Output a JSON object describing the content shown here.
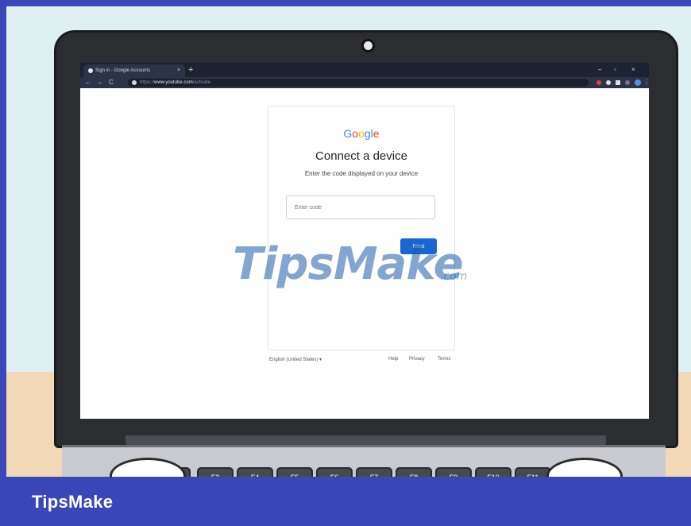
{
  "browser": {
    "tab_title": "Sign in - Google Accounts",
    "tab_close": "×",
    "new_tab": "+",
    "window_controls": {
      "minimize": "–",
      "maximize": "▫",
      "close": "×"
    },
    "nav": {
      "back": "←",
      "forward": "→",
      "reload": "C"
    },
    "url_prefix": "https://",
    "url_host": "www.youtube.com",
    "url_path": "/activate",
    "menu": "⋮"
  },
  "page": {
    "logo_letters": [
      "G",
      "o",
      "o",
      "g",
      "l",
      "e"
    ],
    "logo_colors": [
      "#4285F4",
      "#EA4335",
      "#FBBC05",
      "#4285F4",
      "#34A853",
      "#EA4335"
    ],
    "heading": "Connect a device",
    "subtext": "Enter the code displayed on your device",
    "code_placeholder": "Enter code",
    "next_label": "Next",
    "footer": {
      "language": "English (United States)",
      "language_caret": "▾",
      "links": [
        "Help",
        "Privacy",
        "Terms"
      ]
    }
  },
  "keyboard": {
    "keys": [
      "F2",
      "F3",
      "F4",
      "F5",
      "F6",
      "F7",
      "F8",
      "F9",
      "F10",
      "F11"
    ]
  },
  "watermark": {
    "main": "TipsMake",
    "suffix": ".com"
  },
  "banner": {
    "brand": "TipsMake"
  },
  "colors": {
    "accent": "#1a67d2",
    "banner": "#3a47b8",
    "browser_dark": "#1d2230"
  }
}
